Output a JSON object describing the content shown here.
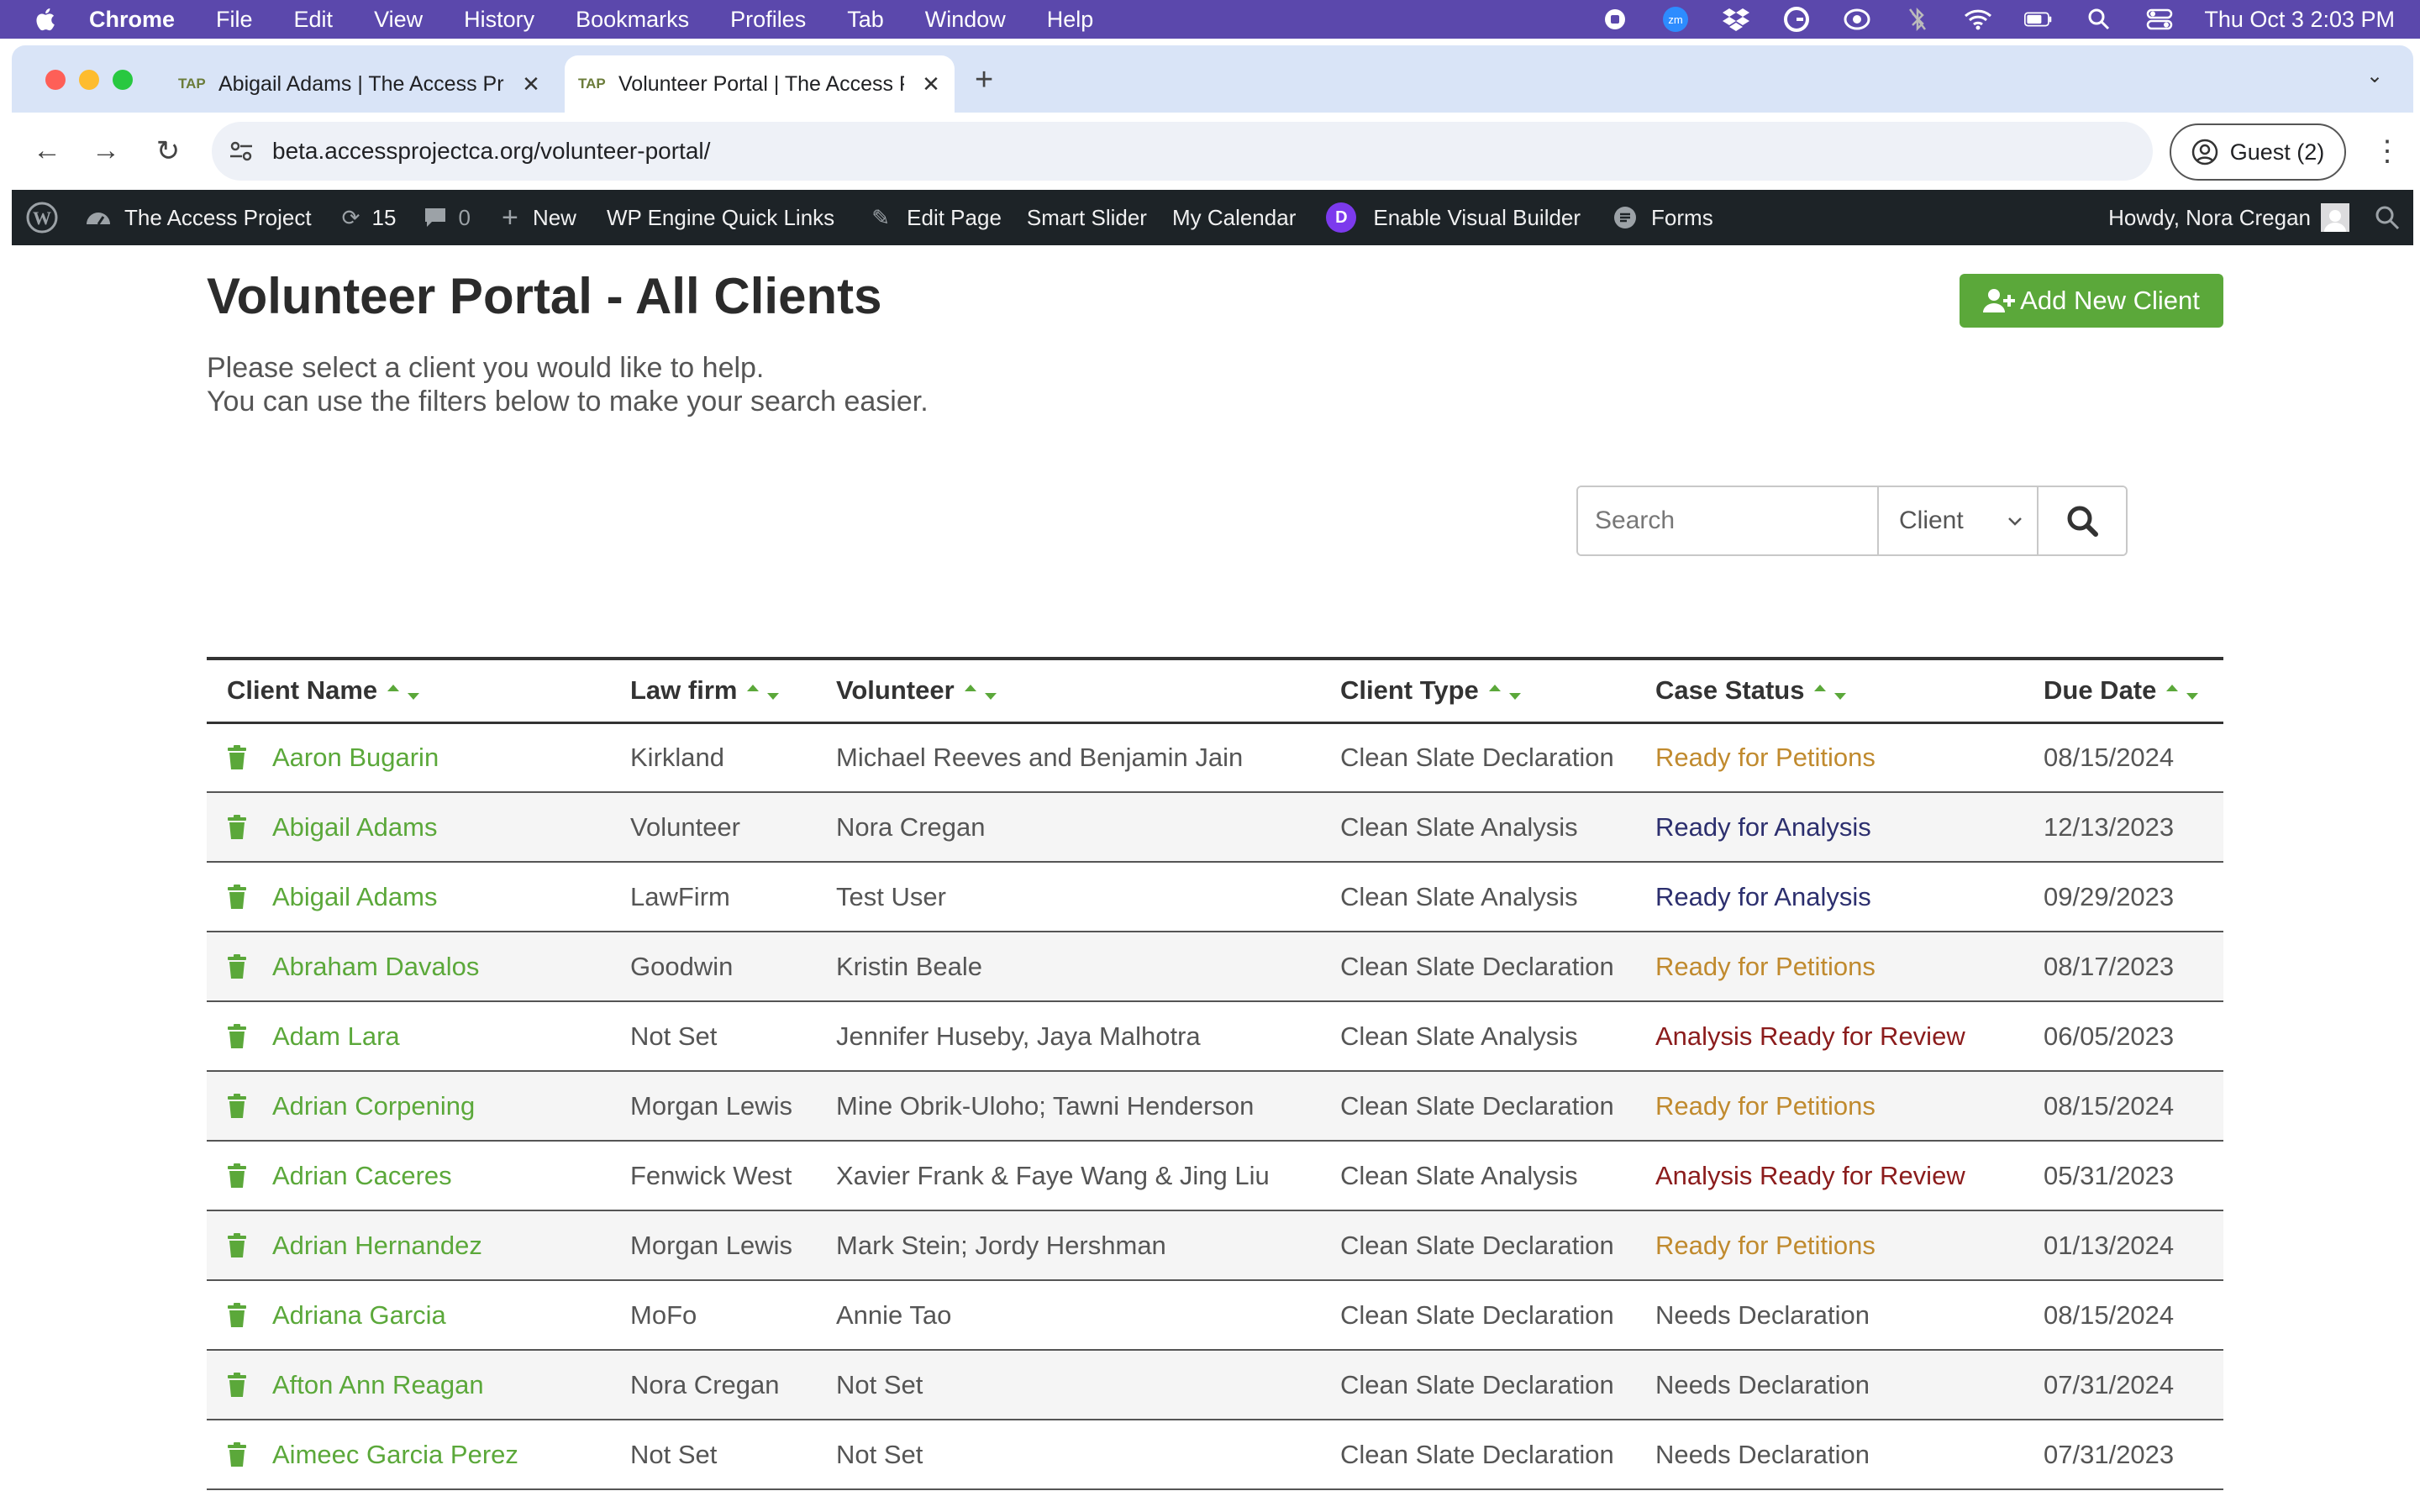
{
  "menubar": {
    "app": "Chrome",
    "items": [
      "File",
      "Edit",
      "View",
      "History",
      "Bookmarks",
      "Profiles",
      "Tab",
      "Window",
      "Help"
    ],
    "clock": "Thu Oct 3  2:03 PM"
  },
  "browser": {
    "tabs": [
      {
        "favicon": "TAP",
        "title": "Abigail Adams | The Access Project"
      },
      {
        "favicon": "TAP",
        "title": "Volunteer Portal | The Access Project"
      }
    ],
    "url": "beta.accessprojectca.org/volunteer-portal/",
    "profile_label": "Guest (2)"
  },
  "wpbar": {
    "site_name": "The Access Project",
    "updates_count": "15",
    "comments_count": "0",
    "new_label": "New",
    "quick_links_label": "WP Engine Quick Links",
    "edit_page_label": "Edit Page",
    "smart_slider_label": "Smart Slider",
    "calendar_label": "My Calendar",
    "visual_builder_label": "Enable Visual Builder",
    "forms_label": "Forms",
    "howdy_label": "Howdy, Nora Cregan"
  },
  "page": {
    "title": "Volunteer Portal - All Clients",
    "add_button_label": "Add New Client",
    "intro_line1": "Please select a client you would like to help.",
    "intro_line2": "You can use the filters below to make your search easier."
  },
  "search": {
    "placeholder": "Search",
    "filter_value": "Client"
  },
  "colors": {
    "accent_green": "#5ba83a",
    "status_petitions": "#c08a2e",
    "status_analysis": "#2c2f6e",
    "status_review": "#8b1c1c",
    "status_default": "#555555"
  },
  "table": {
    "columns": [
      "Client Name",
      "Law firm",
      "Volunteer",
      "Client Type",
      "Case Status",
      "Due Date"
    ],
    "rows": [
      {
        "name": "Aaron Bugarin",
        "firm": "Kirkland",
        "volunteer": "Michael Reeves and Benjamin Jain",
        "type": "Clean Slate Declaration",
        "status": "Ready for Petitions",
        "status_kind": "petitions",
        "due": "08/15/2024"
      },
      {
        "name": "Abigail Adams",
        "firm": "Volunteer",
        "volunteer": "Nora Cregan",
        "type": "Clean Slate Analysis",
        "status": "Ready for Analysis",
        "status_kind": "analysis",
        "due": "12/13/2023"
      },
      {
        "name": "Abigail Adams",
        "firm": "LawFirm",
        "volunteer": "Test User",
        "type": "Clean Slate Analysis",
        "status": "Ready for Analysis",
        "status_kind": "analysis",
        "due": "09/29/2023"
      },
      {
        "name": "Abraham Davalos",
        "firm": "Goodwin",
        "volunteer": "Kristin Beale",
        "type": "Clean Slate Declaration",
        "status": "Ready for Petitions",
        "status_kind": "petitions",
        "due": "08/17/2023"
      },
      {
        "name": "Adam Lara",
        "firm": "Not Set",
        "volunteer": "Jennifer Huseby, Jaya Malhotra",
        "type": "Clean Slate Analysis",
        "status": "Analysis Ready for Review",
        "status_kind": "review",
        "due": "06/05/2023"
      },
      {
        "name": "Adrian Corpening",
        "firm": "Morgan Lewis",
        "volunteer": "Mine Obrik-Uloho; Tawni Henderson",
        "type": "Clean Slate Declaration",
        "status": "Ready for Petitions",
        "status_kind": "petitions",
        "due": "08/15/2024"
      },
      {
        "name": "Adrian Caceres",
        "firm": "Fenwick West",
        "volunteer": "Xavier Frank & Faye Wang & Jing Liu",
        "type": "Clean Slate Analysis",
        "status": "Analysis Ready for Review",
        "status_kind": "review",
        "due": "05/31/2023"
      },
      {
        "name": "Adrian Hernandez",
        "firm": "Morgan Lewis",
        "volunteer": "Mark Stein; Jordy Hershman",
        "type": "Clean Slate Declaration",
        "status": "Ready for Petitions",
        "status_kind": "petitions",
        "due": "01/13/2024"
      },
      {
        "name": "Adriana Garcia",
        "firm": "MoFo",
        "volunteer": "Annie Tao",
        "type": "Clean Slate Declaration",
        "status": "Needs Declaration",
        "status_kind": "default",
        "due": "08/15/2024"
      },
      {
        "name": "Afton Ann Reagan",
        "firm": "Nora Cregan",
        "volunteer": "Not Set",
        "type": "Clean Slate Declaration",
        "status": "Needs Declaration",
        "status_kind": "default",
        "due": "07/31/2024"
      },
      {
        "name": "Aimeec Garcia Perez",
        "firm": "Not Set",
        "volunteer": "Not Set",
        "type": "Clean Slate Declaration",
        "status": "Needs Declaration",
        "status_kind": "default",
        "due": "07/31/2023"
      }
    ]
  }
}
